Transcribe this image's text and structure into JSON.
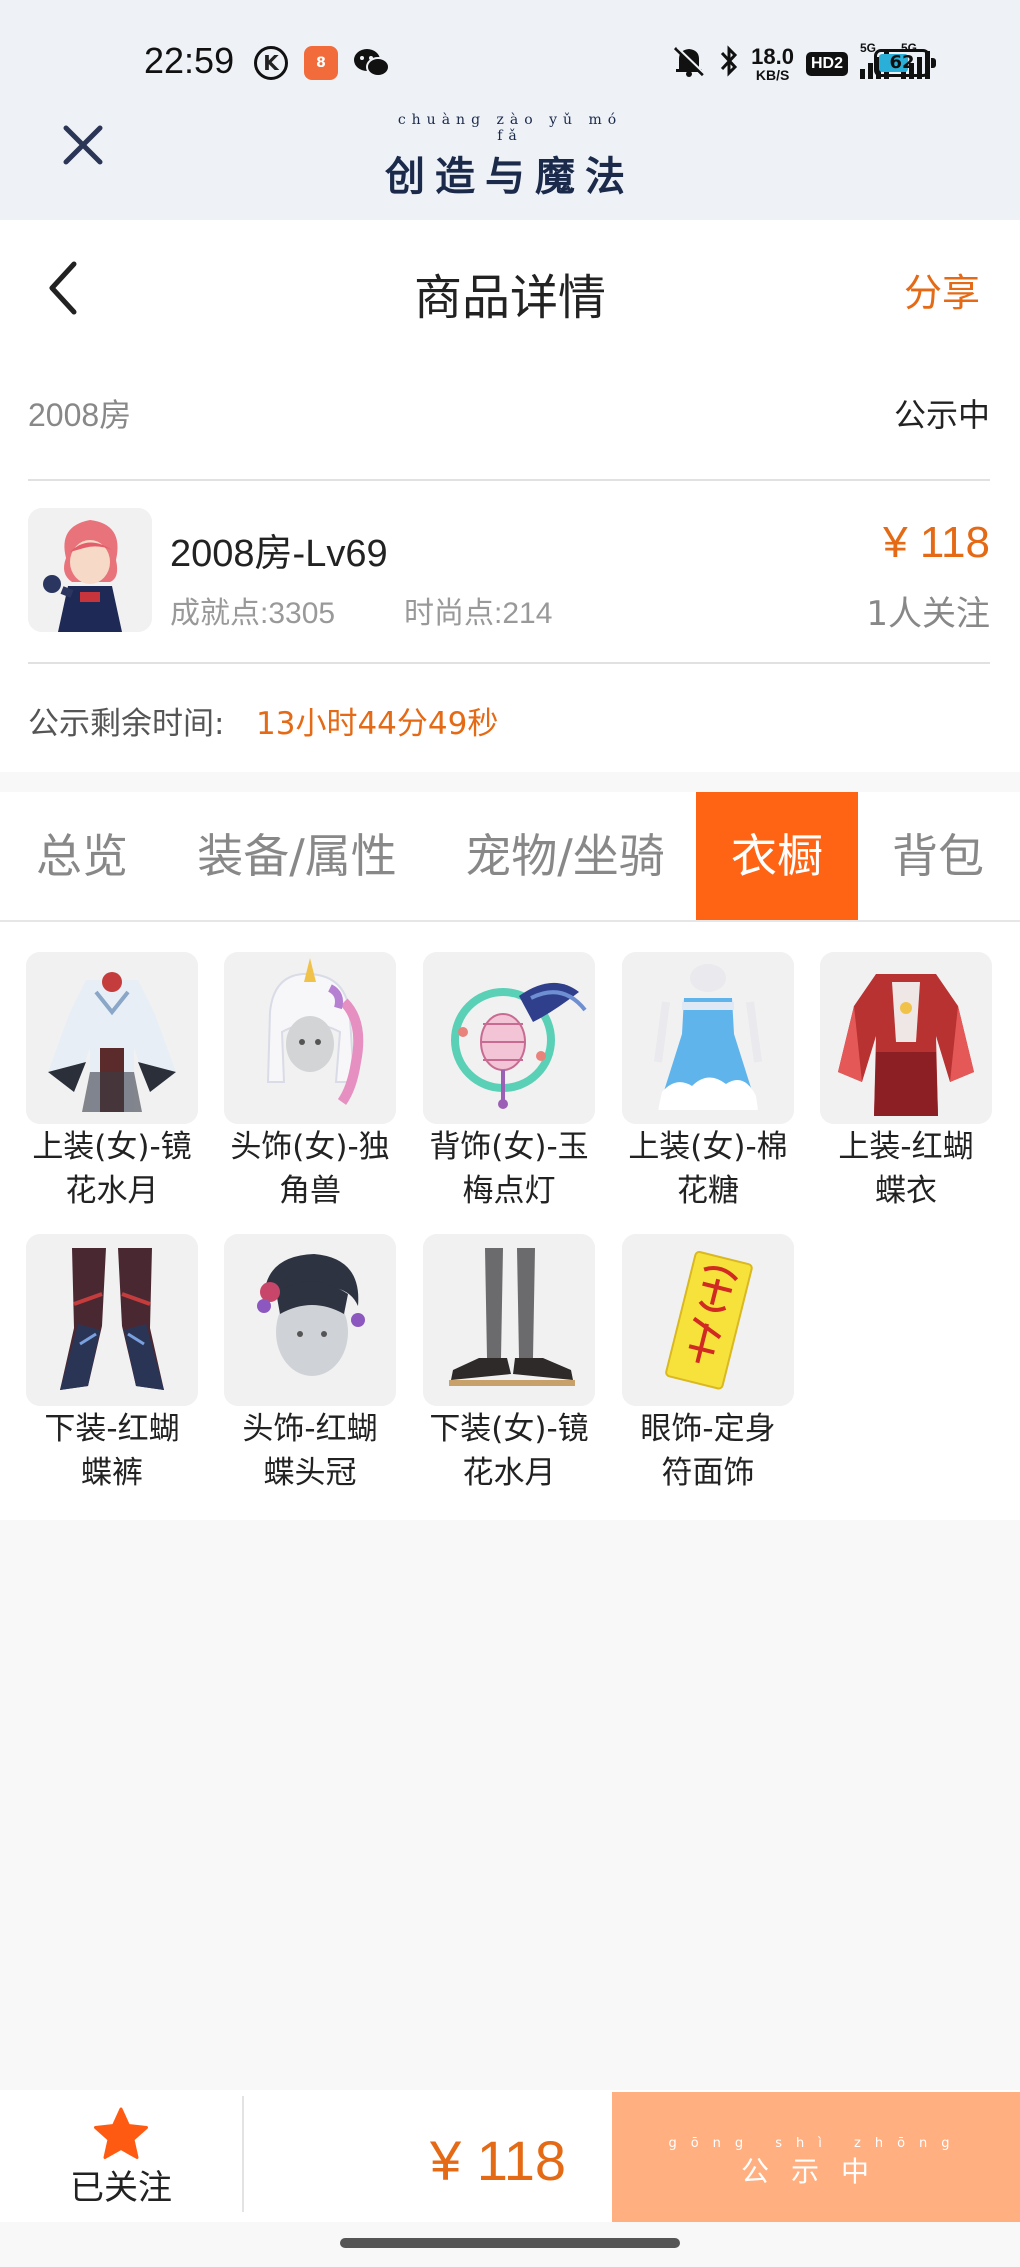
{
  "status_bar": {
    "time": "22:59",
    "k_icon": "K",
    "app_icon_text": "8",
    "net_speed": "18.0",
    "net_unit": "KB/S",
    "hd": "HD2",
    "sig1": "5G",
    "sig2": "5G",
    "battery": "62",
    "battery_level": 0.62
  },
  "app_header": {
    "logo_pinyin": "chuàng zào yǔ mó fǎ",
    "logo_text": "创造与魔法"
  },
  "detail_header": {
    "title": "商品详情",
    "share_label": "分享"
  },
  "listing": {
    "room": "2008房",
    "status": "公示中",
    "name": "2008房-Lv69",
    "achievement": "成就点:3305",
    "fashion": "时尚点:214",
    "price": "¥ 118",
    "followers": "1人关注",
    "remaining_label": "公示剩余时间:",
    "remaining_value": "13小时44分49秒"
  },
  "tabs": [
    {
      "label": "总览"
    },
    {
      "label": "装备/属性"
    },
    {
      "label": "宠物/坐骑"
    },
    {
      "label": "衣橱"
    },
    {
      "label": "背包"
    }
  ],
  "wardrobe": [
    {
      "line1": "上装(女)-镜",
      "line2": "花水月"
    },
    {
      "line1": "头饰(女)-独",
      "line2": "角兽"
    },
    {
      "line1": "背饰(女)-玉",
      "line2": "梅点灯"
    },
    {
      "line1": "上装(女)-棉",
      "line2": "花糖"
    },
    {
      "line1": "上装-红蝴",
      "line2": "蝶衣"
    },
    {
      "line1": "下装-红蝴",
      "line2": "蝶裤"
    },
    {
      "line1": "头饰-红蝴",
      "line2": "蝶头冠"
    },
    {
      "line1": "下装(女)-镜",
      "line2": "花水月"
    },
    {
      "line1": "眼饰-定身",
      "line2": "符面饰"
    }
  ],
  "bottom_bar": {
    "fav_label": "已关注",
    "price": "¥ 118",
    "button_pinyin": "gōng shì zhōng",
    "button_text": "公示中"
  },
  "colors": {
    "accent": "#ff6314",
    "price": "#e46a16",
    "button_disabled": "#ffaf80"
  }
}
